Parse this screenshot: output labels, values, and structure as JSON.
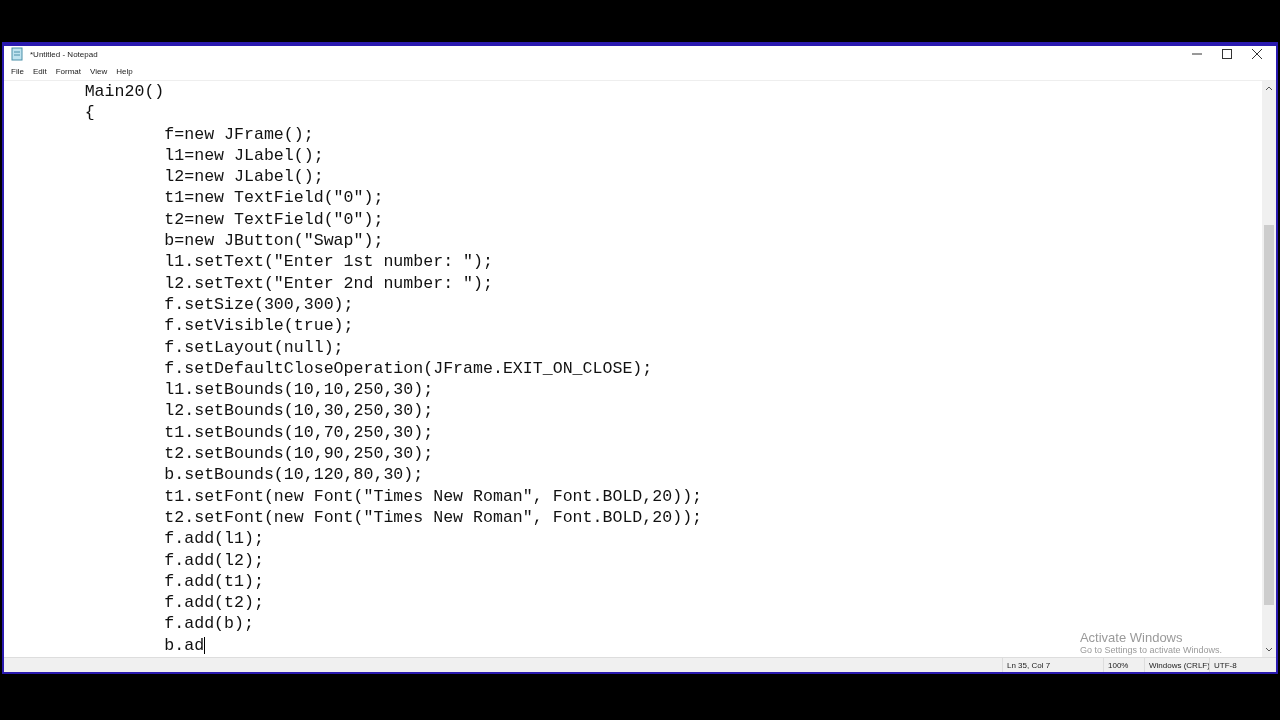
{
  "window": {
    "title": "*Untitled - Notepad"
  },
  "menu": [
    {
      "label": "File"
    },
    {
      "label": "Edit"
    },
    {
      "label": "Format"
    },
    {
      "label": "View"
    },
    {
      "label": "Help"
    }
  ],
  "editor": {
    "lines": [
      "        Main20()",
      "        {",
      "                f=new JFrame();",
      "                l1=new JLabel();",
      "                l2=new JLabel();",
      "                t1=new TextField(\"0\");",
      "                t2=new TextField(\"0\");",
      "                b=new JButton(\"Swap\");",
      "                l1.setText(\"Enter 1st number: \");",
      "                l2.setText(\"Enter 2nd number: \");",
      "                f.setSize(300,300);",
      "                f.setVisible(true);",
      "                f.setLayout(null);",
      "                f.setDefaultCloseOperation(JFrame.EXIT_ON_CLOSE);",
      "                l1.setBounds(10,10,250,30);",
      "                l2.setBounds(10,30,250,30);",
      "                t1.setBounds(10,70,250,30);",
      "                t2.setBounds(10,90,250,30);",
      "                b.setBounds(10,120,80,30);",
      "                t1.setFont(new Font(\"Times New Roman\", Font.BOLD,20));",
      "                t2.setFont(new Font(\"Times New Roman\", Font.BOLD,20));",
      "                f.add(l1);",
      "                f.add(l2);",
      "                f.add(t1);",
      "                f.add(t2);",
      "                f.add(b);",
      "                b.ad"
    ]
  },
  "activation": {
    "title": "Activate Windows",
    "subtitle": "Go to Settings to activate Windows."
  },
  "status_bar": {
    "position": "Ln 35, Col 7",
    "zoom": "100%",
    "line_ending": "Windows (CRLF)",
    "encoding": "UTF-8"
  }
}
